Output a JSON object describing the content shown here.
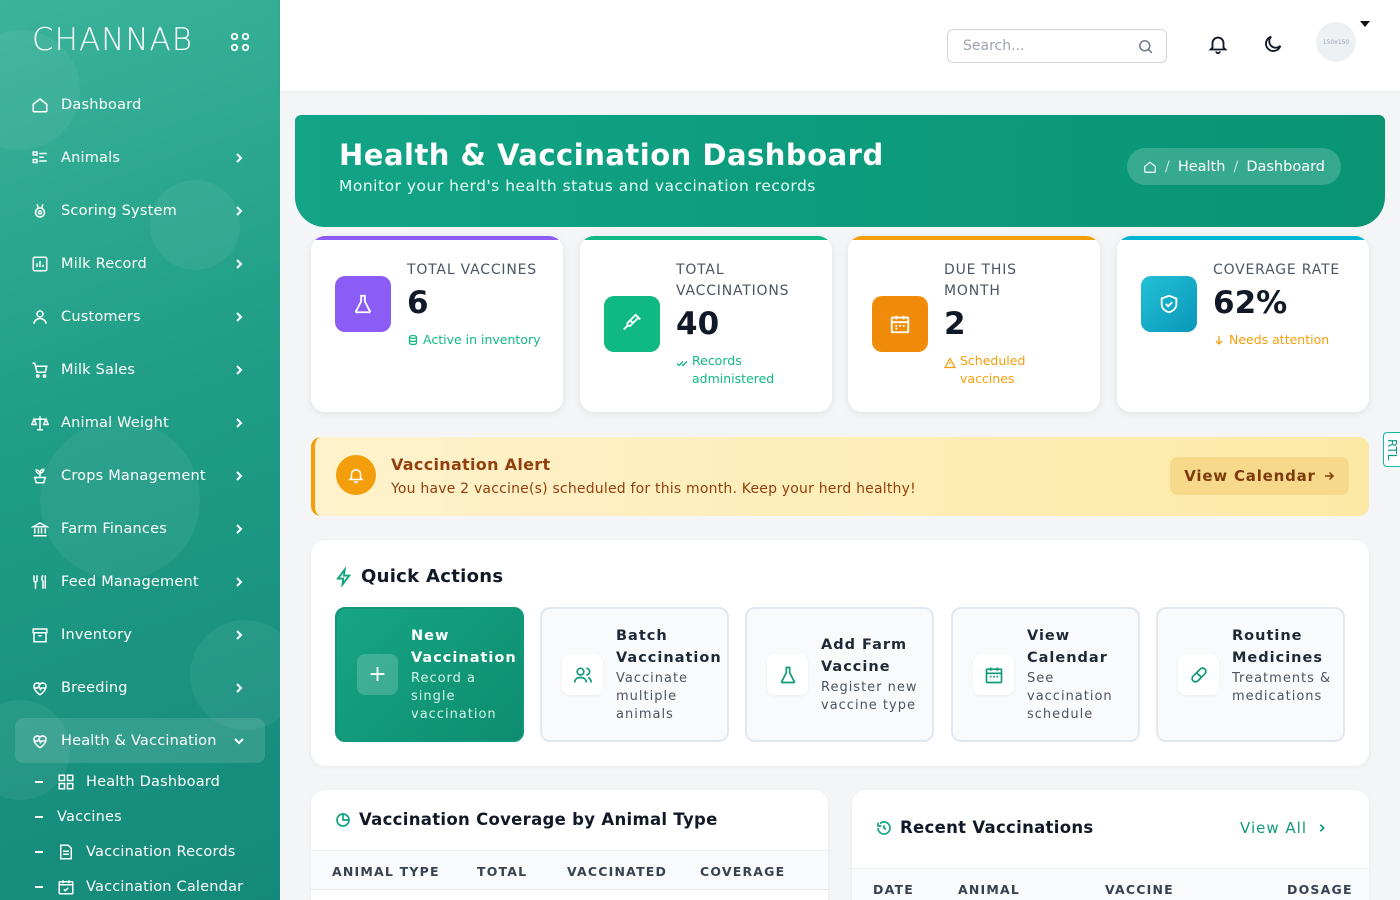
{
  "brand": {
    "name": "CHANNAB"
  },
  "sidebar": {
    "items": [
      {
        "label": "Dashboard",
        "icon": "home-icon",
        "has_children": false
      },
      {
        "label": "Animals",
        "icon": "list-icon",
        "has_children": true
      },
      {
        "label": "Scoring System",
        "icon": "medal-icon",
        "has_children": true
      },
      {
        "label": "Milk Record",
        "icon": "chart-icon",
        "has_children": true
      },
      {
        "label": "Customers",
        "icon": "user-icon",
        "has_children": true
      },
      {
        "label": "Milk Sales",
        "icon": "cart-icon",
        "has_children": true
      },
      {
        "label": "Animal Weight",
        "icon": "scale-icon",
        "has_children": true
      },
      {
        "label": "Crops Management",
        "icon": "plant-icon",
        "has_children": true
      },
      {
        "label": "Farm Finances",
        "icon": "bank-icon",
        "has_children": true
      },
      {
        "label": "Feed Management",
        "icon": "utensils-icon",
        "has_children": true
      },
      {
        "label": "Inventory",
        "icon": "archive-icon",
        "has_children": true
      },
      {
        "label": "Breeding",
        "icon": "heart-pulse-icon",
        "has_children": true
      },
      {
        "label": "Health & Vaccination",
        "icon": "heart-pulse-icon",
        "has_children": true,
        "expanded": true
      }
    ],
    "subitems": [
      {
        "label": "Health Dashboard",
        "icon": "grid-icon"
      },
      {
        "label": "Vaccines",
        "icon": ""
      },
      {
        "label": "Vaccination Records",
        "icon": "document-icon"
      },
      {
        "label": "Vaccination Calendar",
        "icon": "calendar-check-icon"
      }
    ]
  },
  "header": {
    "search_placeholder": "Search...",
    "avatar_text": "150x150"
  },
  "banner": {
    "title": "Health & Vaccination Dashboard",
    "subtitle": "Monitor your herd's health status and vaccination records",
    "breadcrumb": [
      "Health",
      "Dashboard"
    ]
  },
  "stats": [
    {
      "label": "TOTAL VACCINES",
      "value": "6",
      "note": "Active in inventory",
      "color": "#8b5cf6",
      "note_color": "#10b981"
    },
    {
      "label": "TOTAL VACCINATIONS",
      "value": "40",
      "note": "Records administered",
      "color": "#10b981",
      "note_color": "#10b981"
    },
    {
      "label": "DUE THIS MONTH",
      "value": "2",
      "note": "Scheduled vaccines",
      "color": "#f59e0b",
      "note_color": "#f59e0b"
    },
    {
      "label": "COVERAGE RATE",
      "value": "62%",
      "note": "Needs attention",
      "color": "#06b6d4",
      "note_color": "#f59e0b"
    }
  ],
  "alert": {
    "title": "Vaccination Alert",
    "message": "You have 2 vaccine(s) scheduled for this month. Keep your herd healthy!",
    "button": "View Calendar"
  },
  "rtl_label": "RTL",
  "quick_actions": {
    "title": "Quick Actions",
    "items": [
      {
        "title": "New Vaccination",
        "desc": "Record a single vaccination",
        "icon": "plus-icon"
      },
      {
        "title": "Batch Vaccination",
        "desc": "Vaccinate multiple animals",
        "icon": "users-icon"
      },
      {
        "title": "Add Farm Vaccine",
        "desc": "Register new vaccine type",
        "icon": "flask-icon"
      },
      {
        "title": "View Calendar",
        "desc": "See vaccination schedule",
        "icon": "calendar-icon"
      },
      {
        "title": "Routine Medicines",
        "desc": "Treatments & medications",
        "icon": "pill-icon"
      }
    ]
  },
  "coverage": {
    "title": "Vaccination Coverage by Animal Type",
    "columns": [
      "ANIMAL TYPE",
      "TOTAL",
      "VACCINATED",
      "COVERAGE"
    ]
  },
  "recent": {
    "title": "Recent Vaccinations",
    "view_all": "View All",
    "columns": [
      "DATE",
      "ANIMAL",
      "VACCINE",
      "DOSAGE"
    ]
  }
}
